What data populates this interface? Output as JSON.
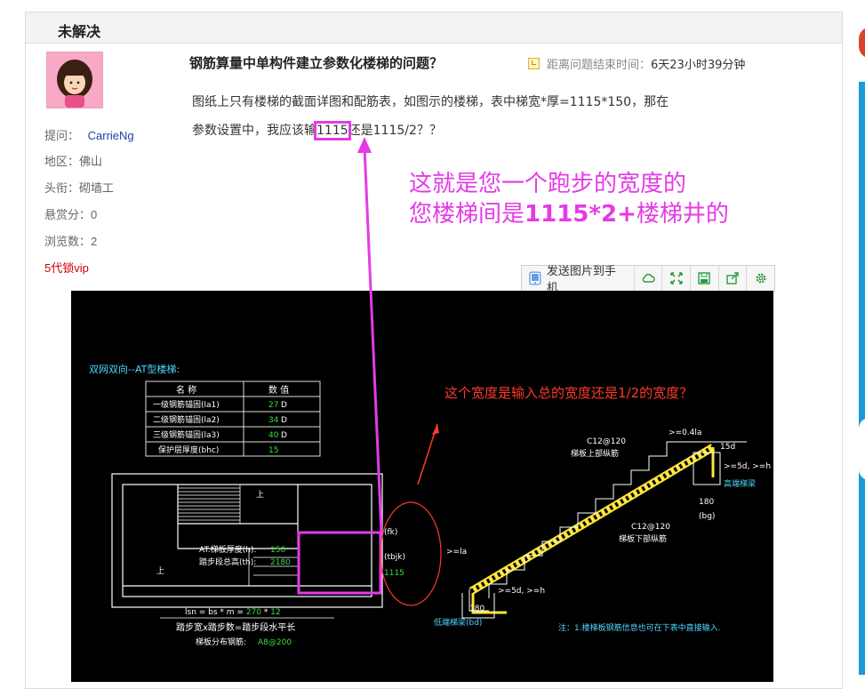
{
  "panel": {
    "title": "未解决"
  },
  "question": {
    "title": "钢筋算量中单构件建立参数化楼梯的问题？",
    "timer_label": "距离问题结束时间：",
    "timer_value": "6天23小时39分钟",
    "body_line1": "图纸上只有楼梯的截面详图和配筋表，如图示的楼梯，表中梯宽*厚=1115*150，那在",
    "body_line2_pre": "参数设置中，我应该输",
    "body_line2_hl": "1115",
    "body_line2_post": "还是1115/2？？"
  },
  "user": {
    "asker_label": "提问：",
    "asker": "CarrieNg",
    "region_label": "地区：",
    "region": "佛山",
    "rank_label": "头衔：",
    "rank": "砌墙工",
    "reward_label": "悬赏分：",
    "reward": "0",
    "views_label": "浏览数：",
    "views": "2",
    "vip": "5代锁vip"
  },
  "annotation": {
    "line1": "这就是您一个跑步的宽度的",
    "line2_pre": "您楼梯间是",
    "line2_bold": "1115*2+",
    "line2_post": "楼梯井的"
  },
  "toolbar": {
    "send_label": "发送图片到手机",
    "icons": [
      "cloud-icon",
      "expand-icon",
      "save-icon",
      "share-icon",
      "gear-icon"
    ]
  },
  "cad": {
    "heading": "双网双向--AT型楼梯:",
    "table_head_name": "名 称",
    "table_head_value": "数 值",
    "rows": [
      {
        "name": "一级钢筋锚固(la1)",
        "value": "27",
        "unit": "D"
      },
      {
        "name": "二级钢筋锚固(la2)",
        "value": "34",
        "unit": "D"
      },
      {
        "name": "三级钢筋锚固(la3)",
        "value": "40",
        "unit": "D"
      },
      {
        "name": "保护层厚度(bhc)",
        "value": "15",
        "unit": ""
      }
    ],
    "red_question": "这个宽度是输入总的宽度还是1/2的宽度？",
    "thickness_label": "AT.梯板厚度(h):",
    "thickness_value": "150",
    "height_label": "踏步段总高(th):",
    "height_value": "2180",
    "fk": "(fk)",
    "tbjk": "(tbjk)",
    "w1115": "1115",
    "lsn_label": "lsn = bs * m = ",
    "lsn_bs": "270",
    "lsn_mul": " * ",
    "lsn_m": "12",
    "tread_line": "踏步宽x踏步数=踏步段水平长",
    "dist_label": "梯板分布钢筋:",
    "dist_value": "A8@200",
    "up1": "上",
    "up2": "上",
    "c12_top": "C12@120",
    "top_bar": "梯板上部纵筋",
    "c12_bot": "C12@120",
    "bot_bar": "梯板下部纵筋",
    "high_beam": "高端梯梁",
    "low_beam": "低端梯梁(bd)",
    "dim_180a": "180",
    "bg": "(bg)",
    "dim_180b": "180",
    "d041": ">=0.4la",
    "d15d": "15d",
    "d5dh": ">=5d, >=h",
    "la": ">=la",
    "d5dh2": ">=5d, >=h",
    "note": "注：1.楼梯板钢筋信息也可在下表中直接输入."
  }
}
